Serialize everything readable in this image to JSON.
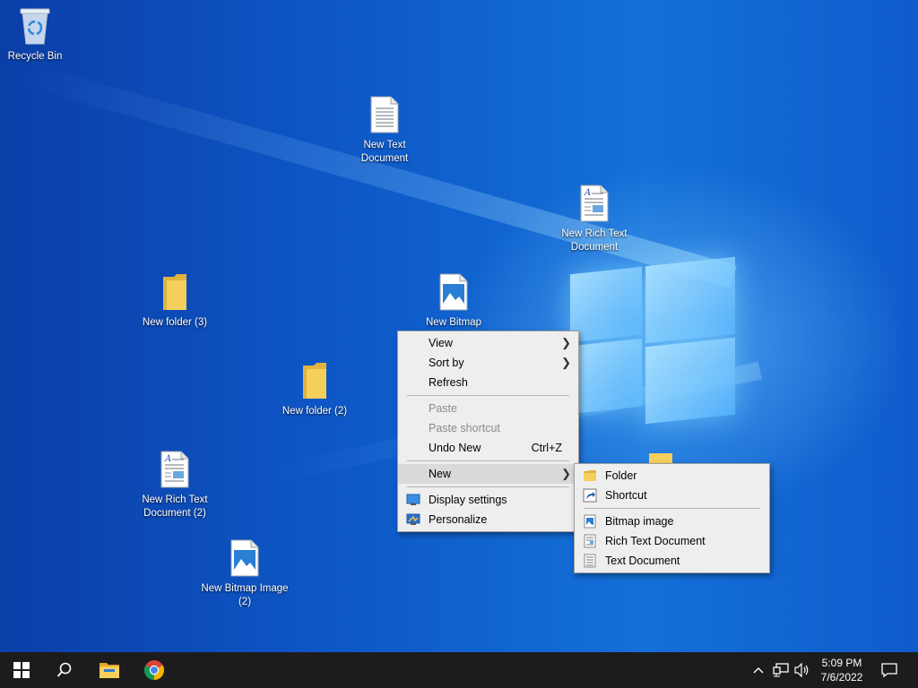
{
  "desktop": {
    "icons": [
      {
        "label": "Recycle Bin",
        "icon": "recycle-bin-icon"
      },
      {
        "label": "New Text Document",
        "icon": "text-document-icon"
      },
      {
        "label": "New Rich Text Document",
        "icon": "rich-text-document-icon"
      },
      {
        "label": "New folder (3)",
        "icon": "folder-icon"
      },
      {
        "label": "New Bitmap",
        "icon": "bitmap-image-icon"
      },
      {
        "label": "New folder (2)",
        "icon": "folder-icon"
      },
      {
        "label": "New Rich Text Document (2)",
        "icon": "rich-text-document-icon"
      },
      {
        "label": "New Bitmap Image (2)",
        "icon": "bitmap-image-icon"
      }
    ]
  },
  "context_menu": {
    "view": "View",
    "sort_by": "Sort by",
    "refresh": "Refresh",
    "paste": "Paste",
    "paste_shortcut": "Paste shortcut",
    "undo_new": "Undo New",
    "undo_shortcut": "Ctrl+Z",
    "new": "New",
    "display_settings": "Display settings",
    "personalize": "Personalize"
  },
  "new_submenu": {
    "folder": "Folder",
    "shortcut": "Shortcut",
    "bitmap_image": "Bitmap image",
    "rich_text_document": "Rich Text Document",
    "text_document": "Text Document"
  },
  "taskbar": {
    "clock_time": "5:09 PM",
    "clock_date": "7/6/2022"
  },
  "colors": {
    "taskbar": "#1c1c1c",
    "menu_bg": "#eeeeee",
    "menu_highlight": "#dadada",
    "folder": "#f5cf5b",
    "desktop_blue": "#0d56c6"
  }
}
